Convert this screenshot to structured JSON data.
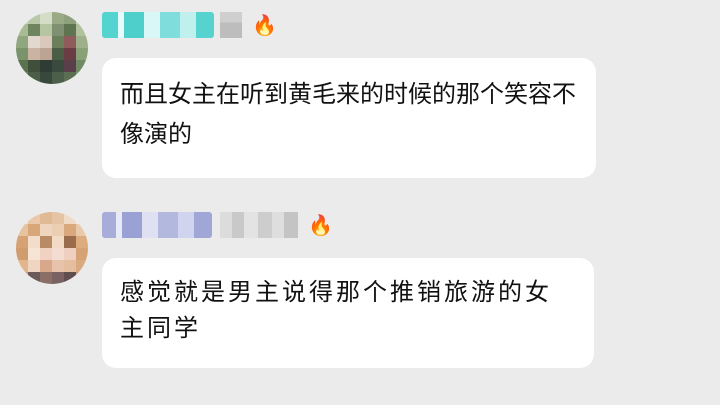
{
  "messages": [
    {
      "badge_icon": "fire-icon",
      "text": "而且女主在听到黄毛来的时候的那个笑容不像演的"
    },
    {
      "badge_icon": "fire-icon",
      "text": "感觉就是男主说得那个推销旅游的女主同学"
    }
  ],
  "colors": {
    "background": "#ebebeb",
    "bubble": "#ffffff",
    "name_tag_1": "#4fd3d0",
    "name_tag_2": "#9fa6d8",
    "fire": "#ff5a1f"
  }
}
